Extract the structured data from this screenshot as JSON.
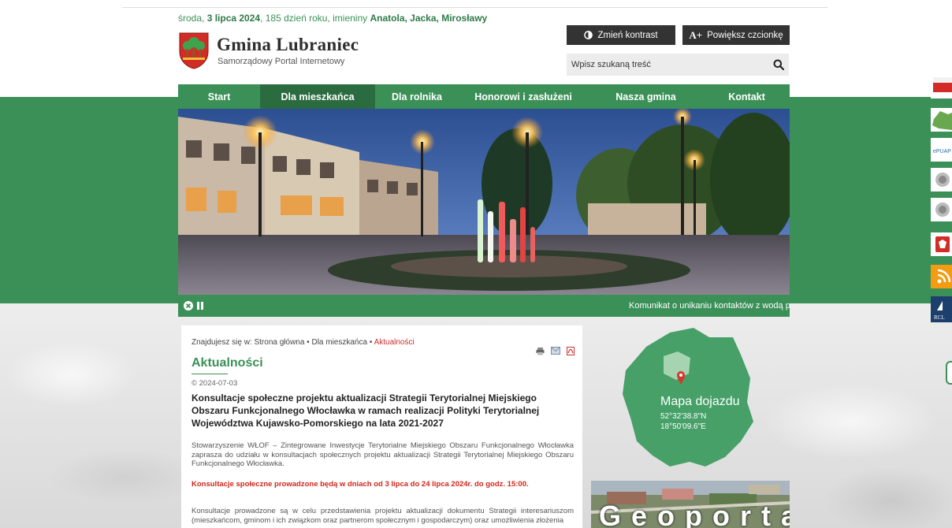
{
  "header": {
    "date_prefix": "środa, ",
    "date_bold": "3 lipca 2024",
    "date_mid": ", 185 dzień roku, imieniny ",
    "names_bold": "Anatola, Jacka, Mirosławy",
    "site_title": "Gmina Lubraniec",
    "site_subtitle": "Samorządowy Portal Internetowy",
    "contrast_label": "Zmień kontrast",
    "font_label": "Powiększ czcionkę",
    "font_glyph": "A+",
    "search_placeholder": "Wpisz szukaną treść"
  },
  "nav": {
    "items": [
      {
        "label": "Start"
      },
      {
        "label": "Dla mieszkańca",
        "active": true
      },
      {
        "label": "Dla rolnika"
      },
      {
        "label": "Honorowi i zasłużeni"
      },
      {
        "label": "Nasza gmina"
      },
      {
        "label": "Kontakt"
      }
    ]
  },
  "slider": {
    "ticker_text": "Komunikat o unikaniu kontaktów z wodą pochodzącą z"
  },
  "content": {
    "breadcrumb_prefix": "Znajdujesz się w: Strona główna • Dla mieszkańca • ",
    "breadcrumb_current": "Aktualności",
    "page_title": "Aktualności",
    "article_date": "© 2024-07-03",
    "article_title": "Konsultacje społeczne projektu aktualizacji Strategii Terytorialnej Miejskiego Obszaru Funkcjonalnego Włocławka w ramach realizacji Polityki Terytorialnej Województwa Kujawsko-Pomorskiego na lata 2021-2027",
    "paragraph1": "Stowarzyszenie WŁOF – Zintegrowane Inwestycje Terytorialne Miejskiego Obszaru Funkcjonalnego Włocławka zaprasza do udziału w konsultacjach społecznych projektu aktualizacji Strategii Terytorialnej Miejskiego Obszaru Funkcjonalnego Włocławka.",
    "red_notice": "Konsultacje społeczne prowadzone będą w dniach od 3 lipca do 24 lipca 2024r. do godz. 15:00.",
    "paragraph2": "Konsultacje prowadzone są w celu przedstawienia projektu aktualizacji dokumentu Strategii interesariuszom (mieszkańcom, gminom i ich związkom oraz partnerom społecznym i gospodarczym) oraz umożliwienia złożenia"
  },
  "map": {
    "label": "Mapa dojazdu",
    "coord_lat": "52°32'38.8\"N",
    "coord_lon": "18°50'09.6\"E"
  },
  "geoportal": {
    "label": "Geoportal"
  },
  "colors": {
    "brand_green": "#3b9058",
    "active_nav": "#2a6b40",
    "notice_red": "#d0261c"
  }
}
